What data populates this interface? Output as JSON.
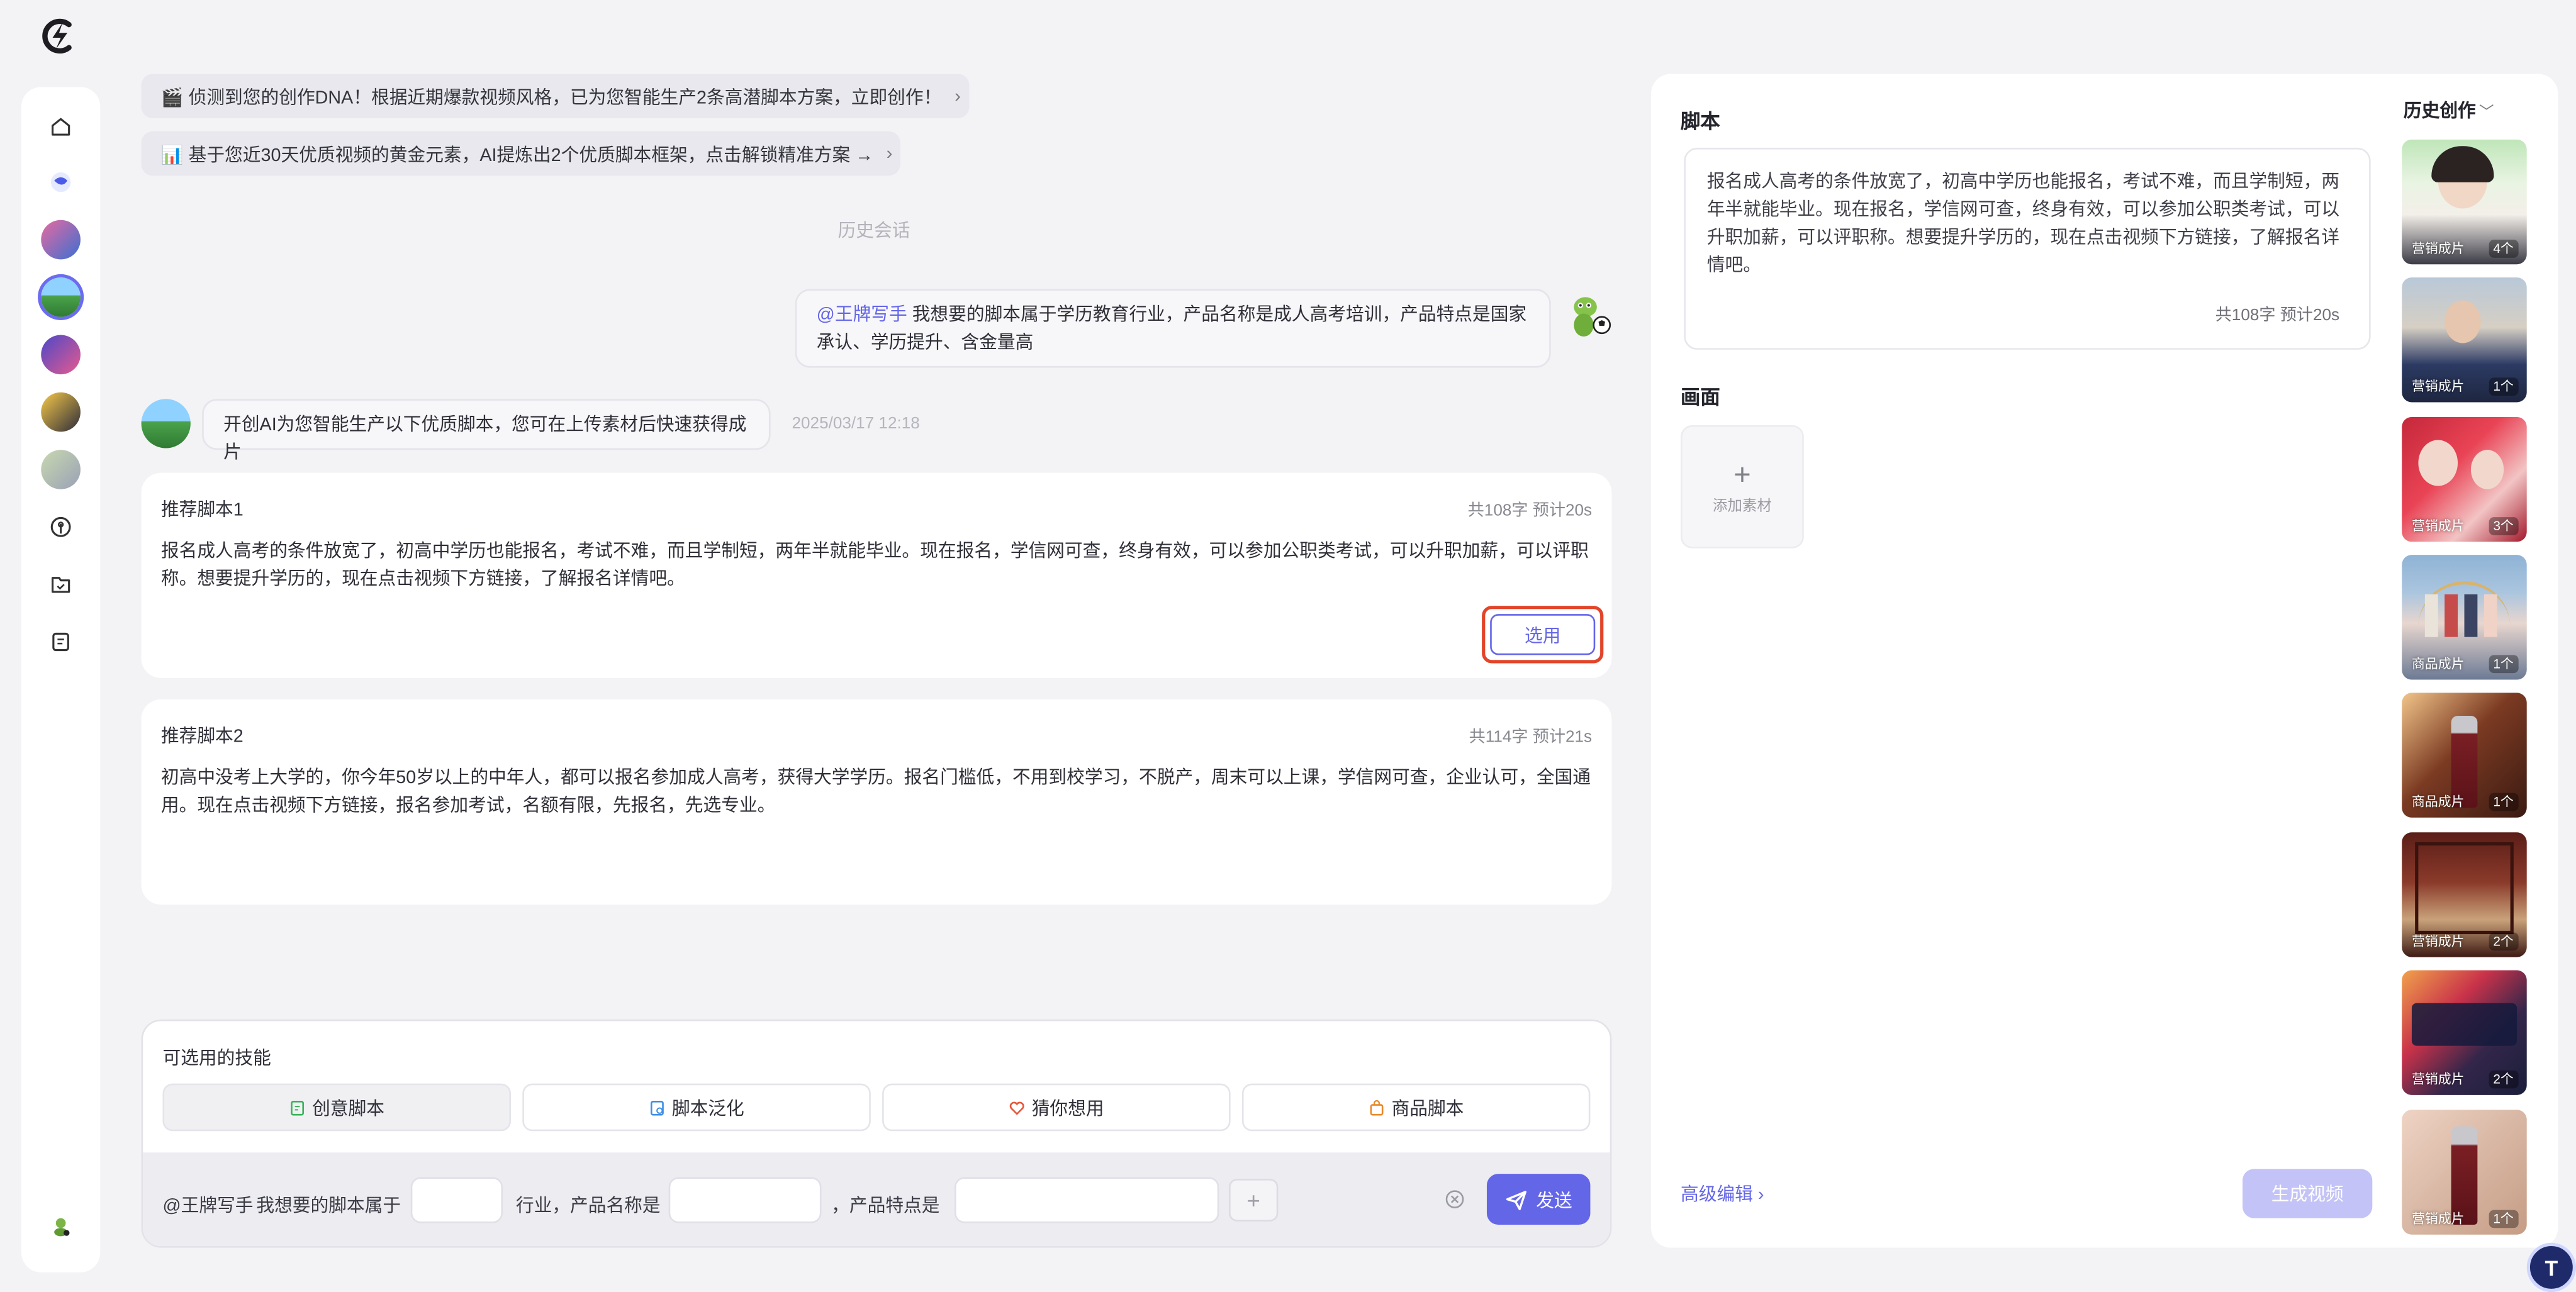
{
  "prompts": {
    "dna_banner": "🎬 侦测到您的创作DNA！根据近期爆款视频风格，已为您智能生产2条高潜脚本方案，立即创作！",
    "golden_banner": "📊 基于您近30天优质视频的黄金元素，AI提炼出2个优质脚本框架，点击解锁精准方案 →"
  },
  "history_label": "历史会话",
  "user_message": {
    "mention": "@王牌写手",
    "text": " 我想要的脚本属于学历教育行业，产品名称是成人高考培训，产品特点是国家承认、学历提升、含金量高"
  },
  "ai_message": {
    "text": "开创AI为您智能生产以下优质脚本，您可在上传素材后快速获得成片",
    "timestamp": "2025/03/17 12:18"
  },
  "scripts": [
    {
      "title": "推荐脚本1",
      "meta": "共108字 预计20s",
      "body": "报名成人高考的条件放宽了，初高中学历也能报名，考试不难，而且学制短，两年半就能毕业。现在报名，学信网可查，终身有效，可以参加公职类考试，可以升职加薪，可以评职称。想要提升学历的，现在点击视频下方链接，了解报名详情吧。",
      "use_label": "选用"
    },
    {
      "title": "推荐脚本2",
      "meta": "共114字 预计21s",
      "body": "初高中没考上大学的，你今年50岁以上的中年人，都可以报名参加成人高考，获得大学学历。报名门槛低，不用到校学习，不脱产，周末可以上课，学信网可查，企业认可，全国通用。现在点击视频下方链接，报名参加考试，名额有限，先报名，先选专业。"
    }
  ],
  "skills": {
    "title": "可选用的技能",
    "items": [
      "创意脚本",
      "脚本泛化",
      "猜你想用",
      "商品脚本"
    ]
  },
  "composer": {
    "mention": "@王牌写手",
    "part1": "我想要的脚本属于",
    "part2": "行业，产品名称是",
    "part3": "，产品特点是",
    "send_label": "发送"
  },
  "right_panel": {
    "script_label": "脚本",
    "script_text": "报名成人高考的条件放宽了，初高中学历也能报名，考试不难，而且学制短，两年半就能毕业。现在报名，学信网可查，终身有效，可以参加公职类考试，可以升职加薪，可以评职称。想要提升学历的，现在点击视频下方链接，了解报名详情吧。",
    "script_meta": "共108字 预计20s",
    "canvas_label": "画面",
    "add_material_label": "添加素材",
    "advanced_edit_label": "高级编辑 ›",
    "generate_label": "生成视频",
    "history_title": "历史创作"
  },
  "history_items": [
    {
      "tag": "营销成片",
      "count": "4个"
    },
    {
      "tag": "营销成片",
      "count": "1个"
    },
    {
      "tag": "营销成片",
      "count": "3个"
    },
    {
      "tag": "商品成片",
      "count": "1个"
    },
    {
      "tag": "商品成片",
      "count": "1个"
    },
    {
      "tag": "营销成片",
      "count": "2个"
    },
    {
      "tag": "营销成片",
      "count": "2个"
    },
    {
      "tag": "营销成片",
      "count": "1个"
    }
  ],
  "colors": {
    "accent": "#6466e8",
    "highlight_frame": "#e2452a"
  },
  "icons": {
    "sidebar": [
      "home-icon",
      "chat-bird-icon",
      "avatar-1",
      "avatar-2",
      "avatar-3",
      "avatar-4",
      "avatar-5",
      "radio-icon",
      "folder-icon",
      "notes-icon"
    ]
  }
}
